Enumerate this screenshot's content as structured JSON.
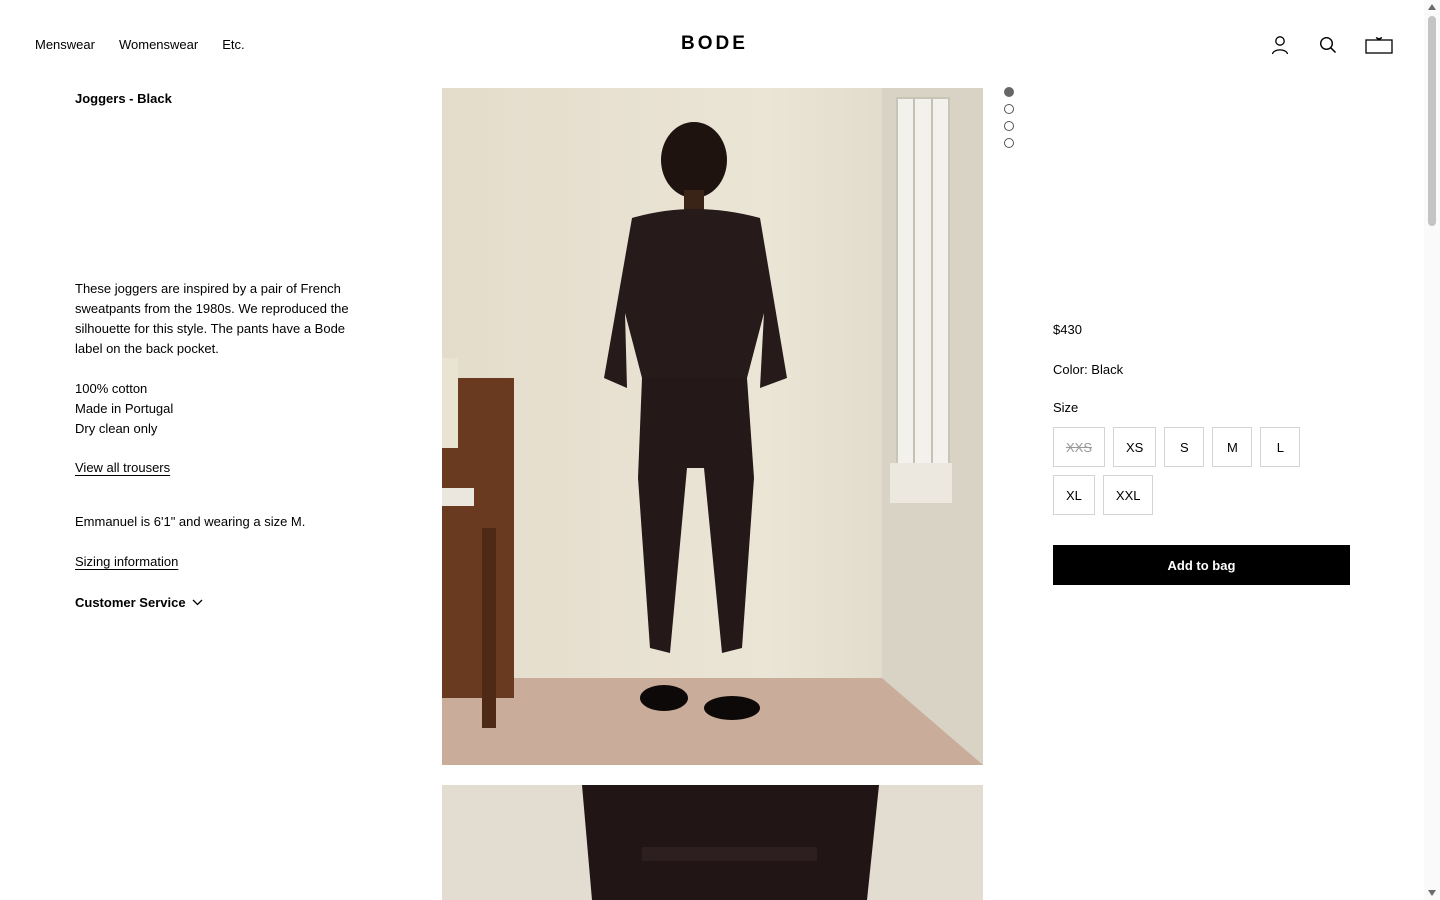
{
  "header": {
    "nav": [
      "Menswear",
      "Womenswear",
      "Etc."
    ],
    "logo": "BODE",
    "icons": [
      "account-icon",
      "search-icon",
      "bag-icon"
    ]
  },
  "product": {
    "title": "Joggers - Black",
    "description": "These joggers are inspired by a pair of French sweatpants from the 1980s. We reproduced the silhouette for this style. The pants have a Bode label on the back pocket.",
    "details": [
      "100% cotton",
      "Made in Portugal",
      "Dry clean only"
    ],
    "view_all": "View all trousers",
    "fit_note": "Emmanuel is 6'1\" and wearing a size M.",
    "sizing_link": "Sizing information",
    "customer_service": "Customer Service"
  },
  "gallery": {
    "count": 4,
    "active_index": 0
  },
  "purchase": {
    "price": "$430",
    "color_label": "Color: Black",
    "size_label": "Size",
    "sizes": [
      {
        "label": "XXS",
        "available": false
      },
      {
        "label": "XS",
        "available": true
      },
      {
        "label": "S",
        "available": true
      },
      {
        "label": "M",
        "available": true
      },
      {
        "label": "L",
        "available": true
      },
      {
        "label": "XL",
        "available": true
      },
      {
        "label": "XXL",
        "available": true
      }
    ],
    "add_button": "Add to bag"
  },
  "colors": {
    "accent": "#000000",
    "border": "#d4d4d4"
  }
}
